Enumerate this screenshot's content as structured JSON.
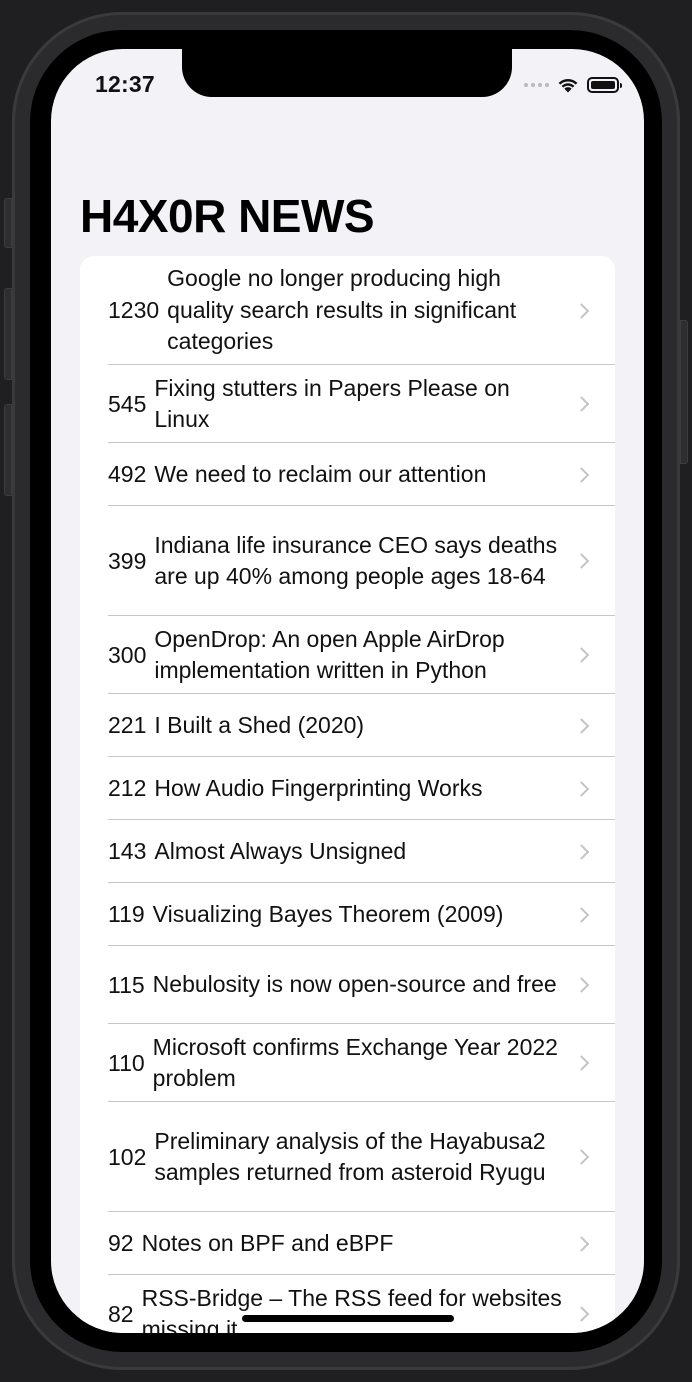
{
  "status_bar": {
    "time": "12:37"
  },
  "page_title": "H4X0R NEWS",
  "stories": [
    {
      "points": "1230",
      "title": "Google no longer producing high quality search results in significant categories"
    },
    {
      "points": "545",
      "title": "Fixing stutters in Papers Please on Linux"
    },
    {
      "points": "492",
      "title": "We need to reclaim our attention"
    },
    {
      "points": "399",
      "title": "Indiana life insurance CEO says deaths are up 40% among people ages 18-64"
    },
    {
      "points": "300",
      "title": "OpenDrop: An open Apple AirDrop implementation written in Python"
    },
    {
      "points": "221",
      "title": "I Built a Shed (2020)"
    },
    {
      "points": "212",
      "title": "How Audio Fingerprinting Works"
    },
    {
      "points": "143",
      "title": "Almost Always Unsigned"
    },
    {
      "points": "119",
      "title": "Visualizing Bayes Theorem (2009)"
    },
    {
      "points": "115",
      "title": "Nebulosity is now open-source and free"
    },
    {
      "points": "110",
      "title": "Microsoft confirms Exchange Year 2022 problem"
    },
    {
      "points": "102",
      "title": "Preliminary analysis of the Hayabusa2 samples returned from asteroid Ryugu"
    },
    {
      "points": "92",
      "title": "Notes on BPF and eBPF"
    },
    {
      "points": "82",
      "title": "RSS-Bridge – The RSS feed for websites missing it"
    }
  ],
  "icons": {
    "row_disclosure": "chevron-right-icon",
    "wifi": "wifi-icon",
    "battery": "battery-icon",
    "signal": "cellular-signal-icon"
  }
}
